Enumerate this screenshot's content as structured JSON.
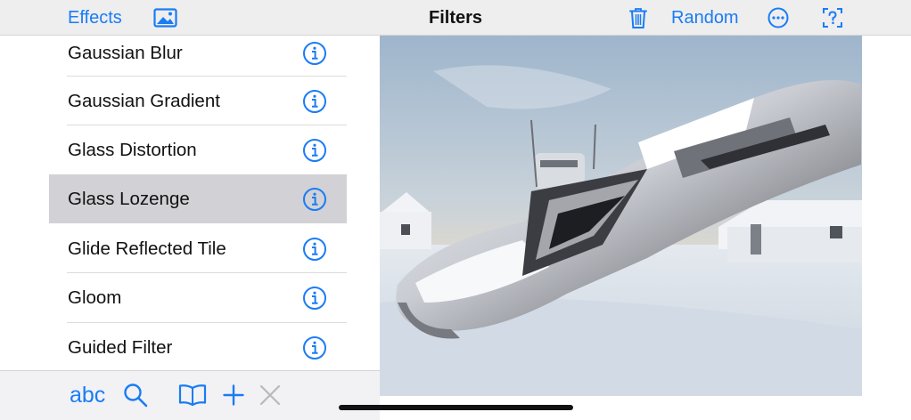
{
  "navbar": {
    "left_label": "Effects",
    "title": "Filters",
    "random_label": "Random",
    "icons": [
      "photo-icon",
      "trash-icon",
      "ellipsis-circle-icon",
      "help-icon"
    ]
  },
  "filters": [
    {
      "label": "Gaussian Blur",
      "selected": false
    },
    {
      "label": "Gaussian Gradient",
      "selected": false
    },
    {
      "label": "Glass Distortion",
      "selected": false
    },
    {
      "label": "Glass Lozenge",
      "selected": true
    },
    {
      "label": "Glide Reflected Tile",
      "selected": false
    },
    {
      "label": "Gloom",
      "selected": false
    },
    {
      "label": "Guided Filter",
      "selected": false
    }
  ],
  "toolbar": {
    "abc_label": "abc",
    "icons": [
      "search-icon",
      "book-icon",
      "plus-icon",
      "close-icon"
    ]
  },
  "colors": {
    "accent": "#1a7cf5",
    "selected_row": "#d1d1d6",
    "bar_background": "#eeeeef"
  }
}
